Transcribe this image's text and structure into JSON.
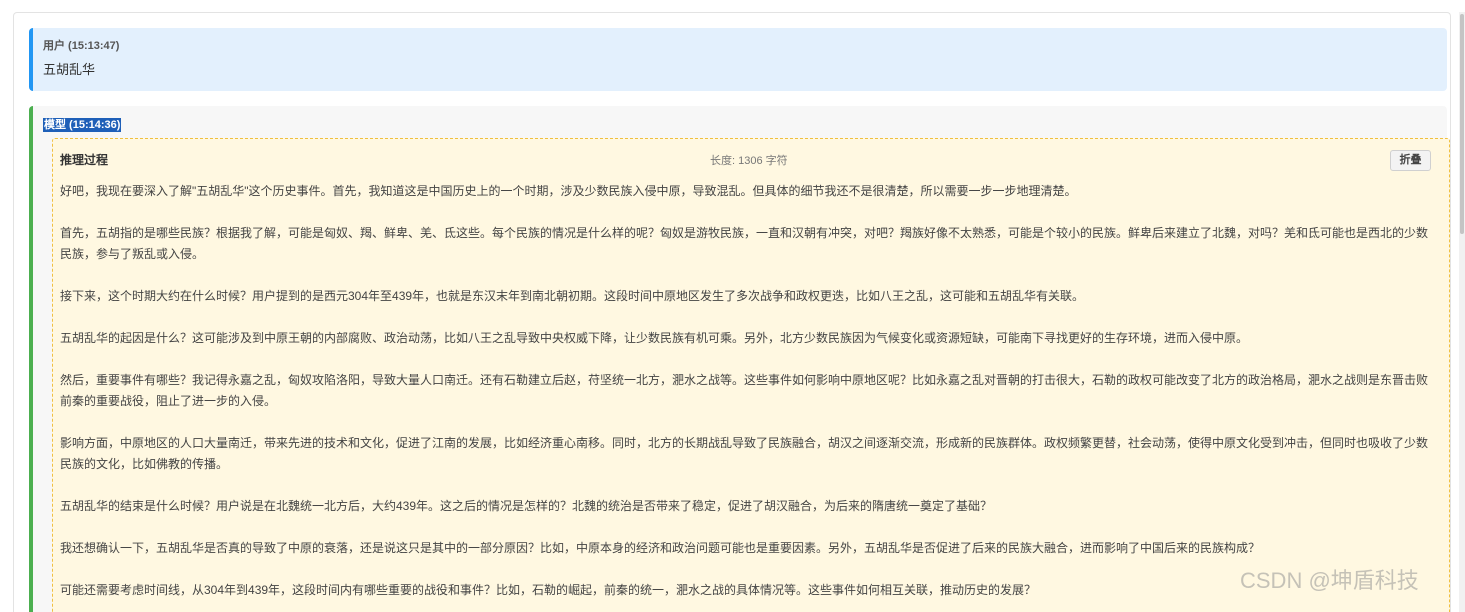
{
  "user_message": {
    "header": "用户 (15:13:47)",
    "text": "五胡乱华"
  },
  "model_message": {
    "header": "模型 (15:14:36)",
    "reasoning": {
      "title": "推理过程",
      "length": "长度: 1306 字符",
      "fold_label": "折叠",
      "paragraphs": [
        "好吧，我现在要深入了解\"五胡乱华\"这个历史事件。首先，我知道这是中国历史上的一个时期，涉及少数民族入侵中原，导致混乱。但具体的细节我还不是很清楚，所以需要一步一步地理清楚。",
        "首先，五胡指的是哪些民族？根据我了解，可能是匈奴、羯、鲜卑、羌、氐这些。每个民族的情况是什么样的呢？匈奴是游牧民族，一直和汉朝有冲突，对吧？羯族好像不太熟悉，可能是个较小的民族。鲜卑后来建立了北魏，对吗？羌和氐可能也是西北的少数民族，参与了叛乱或入侵。",
        "接下来，这个时期大约在什么时候？用户提到的是西元304年至439年，也就是东汉末年到南北朝初期。这段时间中原地区发生了多次战争和政权更迭，比如八王之乱，这可能和五胡乱华有关联。",
        "五胡乱华的起因是什么？这可能涉及到中原王朝的内部腐败、政治动荡，比如八王之乱导致中央权威下降，让少数民族有机可乘。另外，北方少数民族因为气候变化或资源短缺，可能南下寻找更好的生存环境，进而入侵中原。",
        "然后，重要事件有哪些？我记得永嘉之乱，匈奴攻陷洛阳，导致大量人口南迁。还有石勒建立后赵，苻坚统一北方，淝水之战等。这些事件如何影响中原地区呢？比如永嘉之乱对晋朝的打击很大，石勒的政权可能改变了北方的政治格局，淝水之战则是东晋击败前秦的重要战役，阻止了进一步的入侵。",
        "影响方面，中原地区的人口大量南迁，带来先进的技术和文化，促进了江南的发展，比如经济重心南移。同时，北方的长期战乱导致了民族融合，胡汉之间逐渐交流，形成新的民族群体。政权频繁更替，社会动荡，使得中原文化受到冲击，但同时也吸收了少数民族的文化，比如佛教的传播。",
        "五胡乱华的结束是什么时候？用户说是在北魏统一北方后，大约439年。这之后的情况是怎样的？北魏的统治是否带来了稳定，促进了胡汉融合，为后来的隋唐统一奠定了基础？",
        "我还想确认一下，五胡乱华是否真的导致了中原的衰落，还是说这只是其中的一部分原因？比如，中原本身的经济和政治问题可能也是重要因素。另外，五胡乱华是否促进了后来的民族大融合，进而影响了中国后来的民族构成？",
        "可能还需要考虑时间线，从304年到439年，这段时间内有哪些重要的战役和事件？比如，石勒的崛起，前秦的统一，淝水之战的具体情况等。这些事件如何相互关联，推动历史的发展？"
      ]
    }
  },
  "watermark": "CSDN @坤盾科技"
}
